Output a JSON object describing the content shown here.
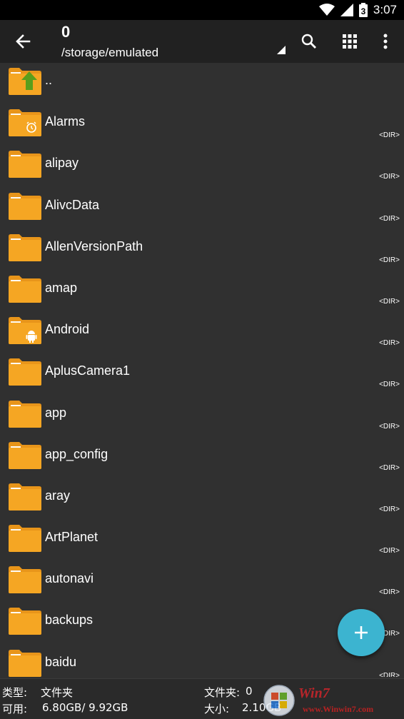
{
  "status_bar": {
    "time": "3:07",
    "battery_level": "3",
    "icons": [
      "wifi-icon",
      "signal-icon",
      "battery-icon"
    ]
  },
  "toolbar": {
    "title": "0",
    "path": "/storage/emulated",
    "icons": [
      "back-arrow-icon",
      "search-icon",
      "grid-view-icon",
      "more-vert-icon"
    ]
  },
  "files": [
    {
      "name": "..",
      "type": "",
      "icon": "up-folder-icon"
    },
    {
      "name": "Alarms",
      "type": "<DIR>",
      "icon": "alarm-folder-icon"
    },
    {
      "name": "alipay",
      "type": "<DIR>",
      "icon": "folder-icon"
    },
    {
      "name": "AlivcData",
      "type": "<DIR>",
      "icon": "folder-icon"
    },
    {
      "name": "AllenVersionPath",
      "type": "<DIR>",
      "icon": "folder-icon"
    },
    {
      "name": "amap",
      "type": "<DIR>",
      "icon": "folder-icon"
    },
    {
      "name": "Android",
      "type": "<DIR>",
      "icon": "android-folder-icon"
    },
    {
      "name": "AplusCamera1",
      "type": "<DIR>",
      "icon": "folder-icon"
    },
    {
      "name": "app",
      "type": "<DIR>",
      "icon": "folder-icon"
    },
    {
      "name": "app_config",
      "type": "<DIR>",
      "icon": "folder-icon"
    },
    {
      "name": "aray",
      "type": "<DIR>",
      "icon": "folder-icon"
    },
    {
      "name": "ArtPlanet",
      "type": "<DIR>",
      "icon": "folder-icon"
    },
    {
      "name": "autonavi",
      "type": "<DIR>",
      "icon": "folder-icon"
    },
    {
      "name": "backups",
      "type": "<DIR>",
      "icon": "folder-icon"
    },
    {
      "name": "baidu",
      "type": "<DIR>",
      "icon": "folder-icon"
    }
  ],
  "fab": {
    "label": "+"
  },
  "footer": {
    "type_label": "类型:",
    "type_value": "文件夹",
    "folders_label": "文件夹:",
    "folders_value": "0",
    "available_label": "可用:",
    "available_value": "6.80GB/ 9.92GB",
    "size_label": "大小:",
    "size_value": "2.10GB"
  },
  "watermark": {
    "text": "Win7",
    "url": "www.Winwin7.com"
  },
  "colors": {
    "folder": "#f5a623",
    "folder_tab": "#e8951a",
    "accent": "#3cb4d0",
    "up_arrow": "#5a9e1c"
  }
}
